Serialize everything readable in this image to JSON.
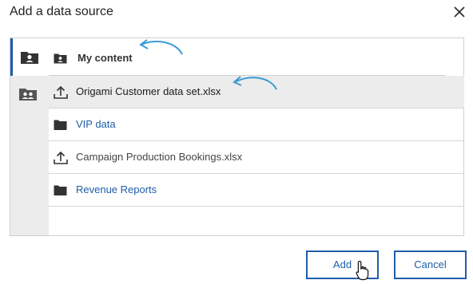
{
  "dialog": {
    "title": "Add a data source"
  },
  "header": {
    "label": "My content"
  },
  "rows": [
    {
      "label": "Origami Customer data set.xlsx",
      "kind": "file"
    },
    {
      "label": "VIP data",
      "kind": "folder"
    },
    {
      "label": "Campaign Production Bookings.xlsx",
      "kind": "file"
    },
    {
      "label": "Revenue Reports",
      "kind": "folder"
    }
  ],
  "buttons": {
    "add": "Add",
    "cancel": "Cancel"
  },
  "colors": {
    "accent": "#1f5ea8",
    "annotation_arrow": "#3a9bd5",
    "selected_row": "#ececec",
    "rail": "#ececec"
  },
  "icons": {
    "close": "close-icon",
    "rail_top": "user-folder-icon",
    "rail_second": "team-folder-icon",
    "header": "user-folder-icon",
    "file": "upload-icon",
    "folder": "folder-icon"
  }
}
